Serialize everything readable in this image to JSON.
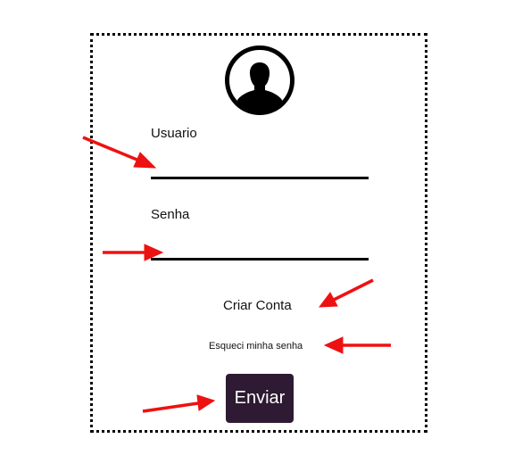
{
  "form": {
    "username_label": "Usuario",
    "username_value": "",
    "password_label": "Senha",
    "password_value": "",
    "create_account_link": "Criar Conta",
    "forgot_password_link": "Esqueci minha senha",
    "submit_label": "Enviar"
  },
  "icons": {
    "avatar": "user-avatar-icon",
    "annotation": "red-arrow"
  },
  "colors": {
    "submit_background": "#2e1a33",
    "submit_text": "#ffffff",
    "annotation_arrow": "#ee1111",
    "frame_border": "#000000"
  }
}
